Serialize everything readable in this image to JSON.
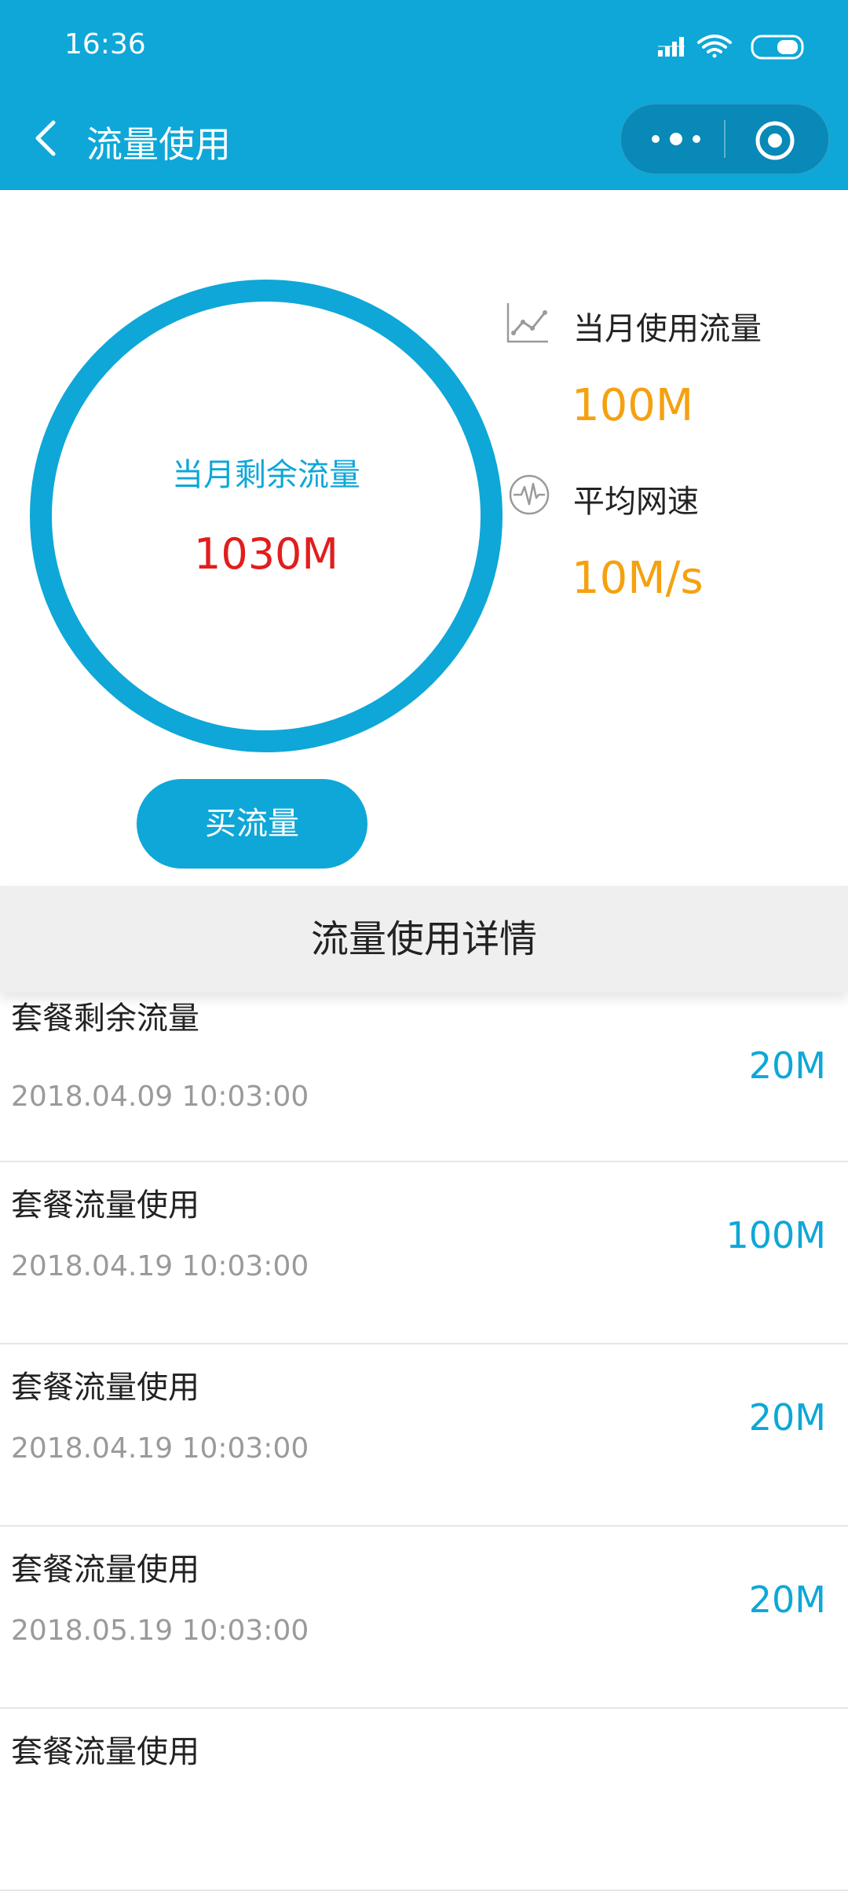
{
  "status_bar": {
    "time": "16:36"
  },
  "nav": {
    "title": "流量使用"
  },
  "summary": {
    "remaining_label": "当月剩余流量",
    "remaining_value": "1030M",
    "used_label": "当月使用流量",
    "used_value": "100M",
    "speed_label": "平均网速",
    "speed_value": "10M/s"
  },
  "buy_button": {
    "label": "买流量"
  },
  "details": {
    "header": "流量使用详情",
    "items": [
      {
        "name": "套餐剩余流量",
        "time": "2018.04.09 10:03:00",
        "amount": "20M"
      },
      {
        "name": "套餐流量使用",
        "time": "2018.04.19 10:03:00",
        "amount": "100M"
      },
      {
        "name": "套餐流量使用",
        "time": "2018.04.19 10:03:00",
        "amount": "20M"
      },
      {
        "name": "套餐流量使用",
        "time": "2018.05.19 10:03:00",
        "amount": "20M"
      },
      {
        "name": "套餐流量使用",
        "time": "",
        "amount": ""
      }
    ]
  },
  "colors": {
    "primary": "#0ea7d8",
    "accent": "#f5a10f",
    "alert": "#e21d1d"
  }
}
